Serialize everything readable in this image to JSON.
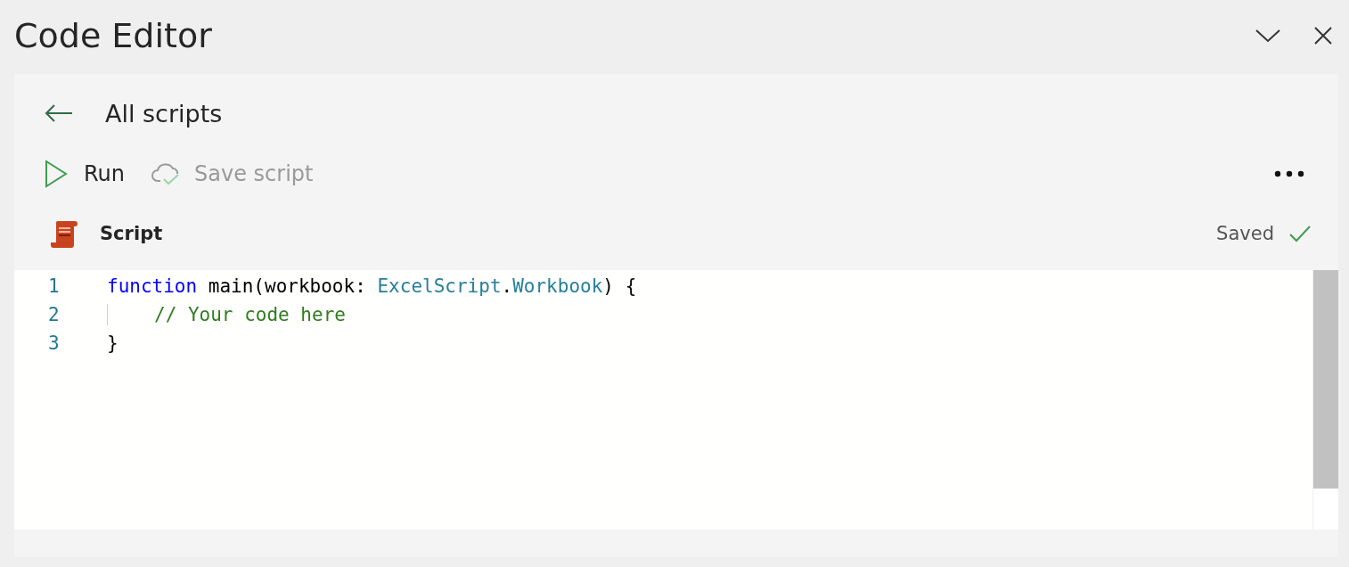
{
  "window": {
    "title": "Code Editor"
  },
  "nav": {
    "back_label": "All scripts"
  },
  "toolbar": [
    {
      "label": "Run",
      "kind": "run",
      "disabled": false
    },
    {
      "label": "Save script",
      "kind": "save",
      "disabled": true
    }
  ],
  "script": {
    "name": "Script",
    "status": "Saved"
  },
  "editor": {
    "lines": [
      {
        "number": "1",
        "indented": false,
        "tokens": [
          {
            "text": "function ",
            "kind": "keyword"
          },
          {
            "text": "main(workbook: ",
            "kind": "plain"
          },
          {
            "text": "ExcelScript",
            "kind": "type"
          },
          {
            "text": ".",
            "kind": "plain"
          },
          {
            "text": "Workbook",
            "kind": "type"
          },
          {
            "text": ") {",
            "kind": "plain"
          }
        ]
      },
      {
        "number": "2",
        "indented": true,
        "tokens": [
          {
            "text": "// Your code here",
            "kind": "comment"
          }
        ]
      },
      {
        "number": "3",
        "indented": false,
        "tokens": [
          {
            "text": "}",
            "kind": "plain"
          }
        ]
      }
    ]
  }
}
